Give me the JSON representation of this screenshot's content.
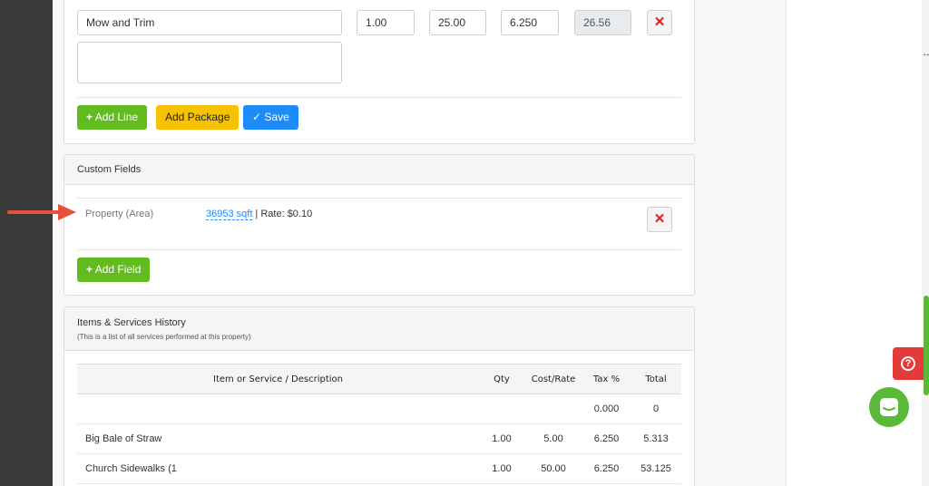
{
  "line_item": {
    "name": "Mow and Trim",
    "qty": "1.00",
    "rate": "25.00",
    "tax": "6.250",
    "total": "26.56",
    "notes": "",
    "remove_icon": "close-icon"
  },
  "line_actions": {
    "add_line": "Add Line",
    "add_package": "Add Package",
    "save": "Save"
  },
  "custom_fields": {
    "title": "Custom Fields",
    "fields": [
      {
        "label": "Property (Area)",
        "value_link": "36953 sqft",
        "value_rest": " | Rate: $0.10"
      }
    ],
    "add_field": "Add Field"
  },
  "history": {
    "title": "Items & Services History",
    "subtitle": "(This is a list of all services performed at this property)",
    "columns": [
      "Item or Service / Description",
      "Qty",
      "Cost/Rate",
      "Tax %",
      "Total"
    ],
    "rows": [
      [
        "",
        "",
        "",
        "0.000",
        "0"
      ],
      [
        "Big Bale of Straw",
        "1.00",
        "5.00",
        "6.250",
        "5.313"
      ],
      [
        "Church Sidewalks (1",
        "1.00",
        "50.00",
        "6.250",
        "53.125"
      ]
    ]
  },
  "colors": {
    "green": "#62bb1f",
    "yellow": "#f7c300",
    "blue": "#1d8cf8",
    "danger": "#e02020",
    "arrow": "#e8503e"
  },
  "icons": {
    "help": "help-icon",
    "chat": "chat-icon",
    "plus": "plus-icon",
    "check": "check-icon"
  }
}
